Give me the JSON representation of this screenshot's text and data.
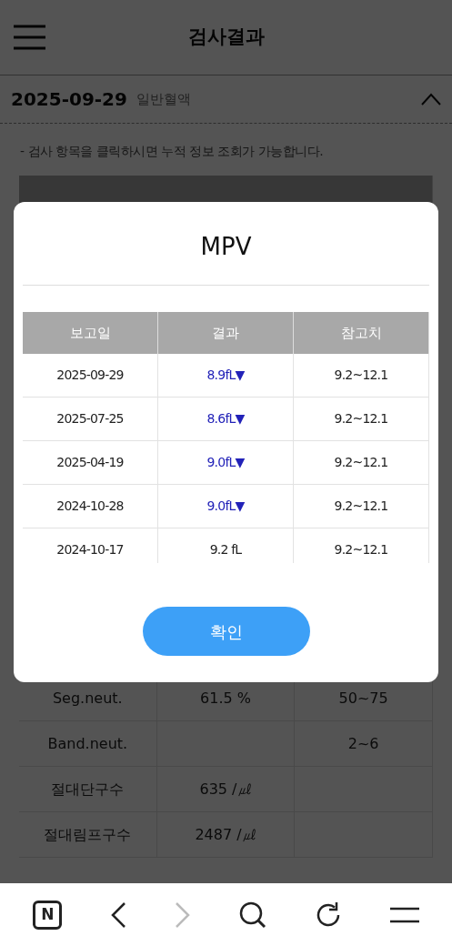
{
  "header": {
    "title": "검사결과"
  },
  "section": {
    "date": "2025-09-29",
    "category": "일반혈액",
    "expanded": true
  },
  "note": "- 검사 항목을 클릭하시면 누적 정보 조회가 가능합니다.",
  "table": {
    "rows": [
      {
        "name": "Seg.neut.",
        "result": "61.5 %",
        "reference": "50~75"
      },
      {
        "name": "Band.neut.",
        "result": "",
        "reference": "2~6"
      },
      {
        "name": "절대단구수",
        "result": "635 /㎕",
        "reference": ""
      },
      {
        "name": "절대림프구수",
        "result": "2487 /㎕",
        "reference": ""
      }
    ]
  },
  "dialog": {
    "title": "MPV",
    "columns": [
      "보고일",
      "결과",
      "참고치"
    ],
    "rows": [
      {
        "date": "2025-09-29",
        "result": "8.9fL",
        "arrow": "▼",
        "low": true,
        "reference": "9.2~12.1"
      },
      {
        "date": "2025-07-25",
        "result": "8.6fL",
        "arrow": "▼",
        "low": true,
        "reference": "9.2~12.1"
      },
      {
        "date": "2025-04-19",
        "result": "9.0fL",
        "arrow": "▼",
        "low": true,
        "reference": "9.2~12.1"
      },
      {
        "date": "2024-10-28",
        "result": "9.0fL",
        "arrow": "▼",
        "low": true,
        "reference": "9.2~12.1"
      },
      {
        "date": "2024-10-17",
        "result": "9.2 fL",
        "low": false,
        "reference": "9.2~12.1"
      }
    ],
    "confirm": "확인"
  },
  "browser_bar": {
    "logo": "N",
    "forward_disabled": true
  }
}
